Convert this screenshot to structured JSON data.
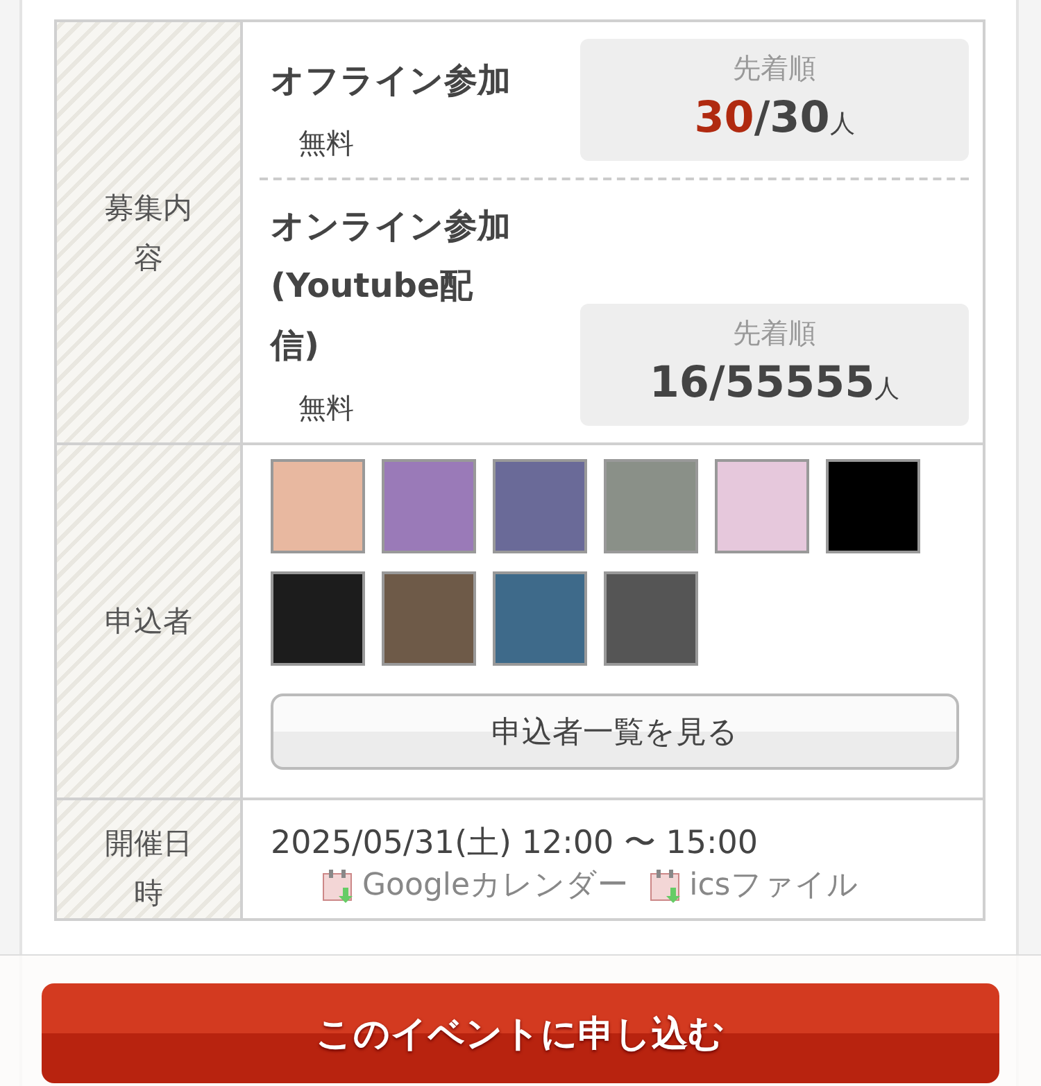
{
  "sections": [
    {
      "kind": "plans",
      "label": "募集内容",
      "plans": [
        {
          "name": "オフライン参加",
          "fee": "無料",
          "method": "先着順",
          "applied": "30",
          "capacity": "/30",
          "unit": "人",
          "full": true
        },
        {
          "name": "オンライン参加(Youtube配信)",
          "fee": "無料",
          "method": "先着順",
          "applied": "16",
          "capacity": "/55555",
          "unit": "人",
          "full": false
        }
      ]
    },
    {
      "kind": "applicants",
      "label": "申込者",
      "avatars": [
        {
          "color": "#e8b8a0"
        },
        {
          "color": "#9a7ab8"
        },
        {
          "color": "#6a6a98"
        },
        {
          "color": "#8a9088"
        },
        {
          "color": "#e6c8dc"
        },
        {
          "color": "#000000"
        },
        {
          "color": "#1c1c1c"
        },
        {
          "color": "#6e5a48"
        },
        {
          "color": "#3e6a8a"
        },
        {
          "color": "#555555"
        }
      ],
      "button": "申込者一覧を見る"
    },
    {
      "kind": "datetime",
      "label": "開催日時",
      "datetime": "2025/05/31(土) 12:00 〜 15:00",
      "links": [
        {
          "label": "Googleカレンダー"
        },
        {
          "label": "icsファイル"
        }
      ]
    }
  ],
  "apply_button": "このイベントに申し込む"
}
